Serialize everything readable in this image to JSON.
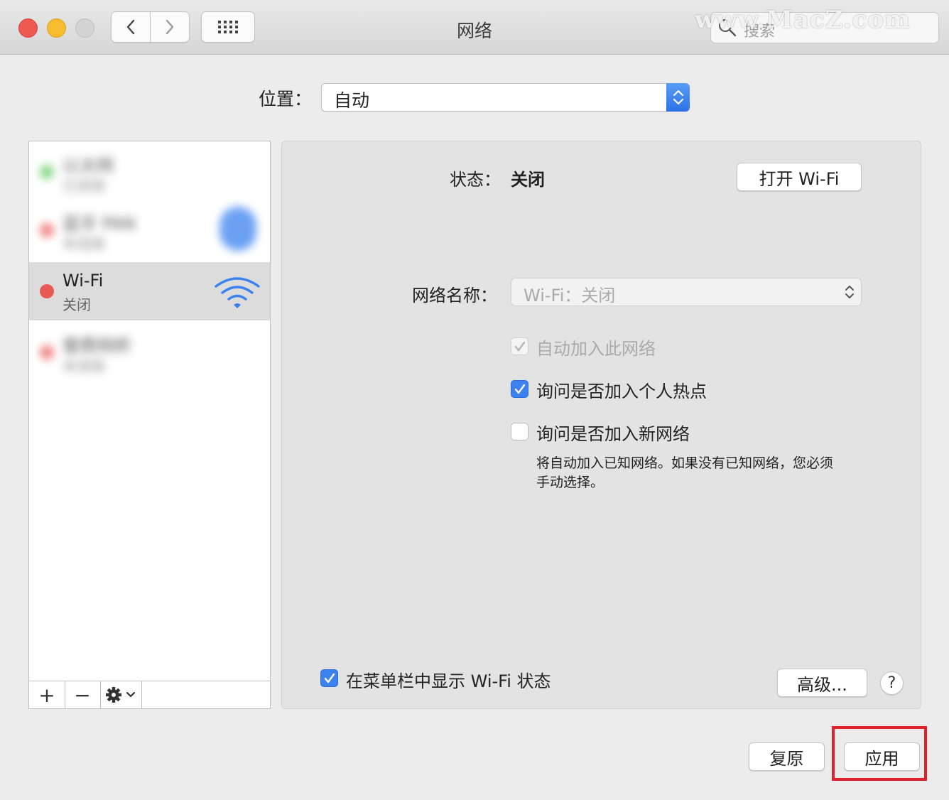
{
  "window": {
    "title": "网络",
    "search_placeholder": "搜索",
    "watermark": "www.MacZ.com"
  },
  "location": {
    "label": "位置：",
    "value": "自动"
  },
  "sidebar": {
    "services": [
      {
        "name": "以太网",
        "status": "已连接",
        "dot": "#5ac95a",
        "blurred": true
      },
      {
        "name": "蓝牙 PAN",
        "status": "未连接",
        "dot": "#e85a55",
        "blurred": true
      },
      {
        "name": "Wi-Fi",
        "status": "关闭",
        "dot": "#e85a55",
        "selected": true
      },
      {
        "name": "雷雳网桥",
        "status": "未连接",
        "dot": "#e85a55",
        "blurred": true
      }
    ],
    "add_symbol": "+",
    "remove_symbol": "−"
  },
  "panel": {
    "status_label": "状态：",
    "status_value": "关闭",
    "toggle_wifi_button": "打开 Wi-Fi",
    "network_name_label": "网络名称：",
    "network_name_value": "Wi-Fi：关闭",
    "auto_join_label": "自动加入此网络",
    "ask_hotspot_label": "询问是否加入个人热点",
    "ask_new_label": "询问是否加入新网络",
    "ask_new_desc_line1": "将自动加入已知网络。如果没有已知网络，您必须",
    "ask_new_desc_line2": "手动选择。",
    "show_menubar_label": "在菜单栏中显示 Wi-Fi 状态",
    "advanced_button": "高级...",
    "help_button": "?"
  },
  "footer": {
    "revert_button": "复原",
    "apply_button": "应用"
  },
  "colors": {
    "accent": "#3b82f0",
    "highlight": "#e0202a"
  }
}
